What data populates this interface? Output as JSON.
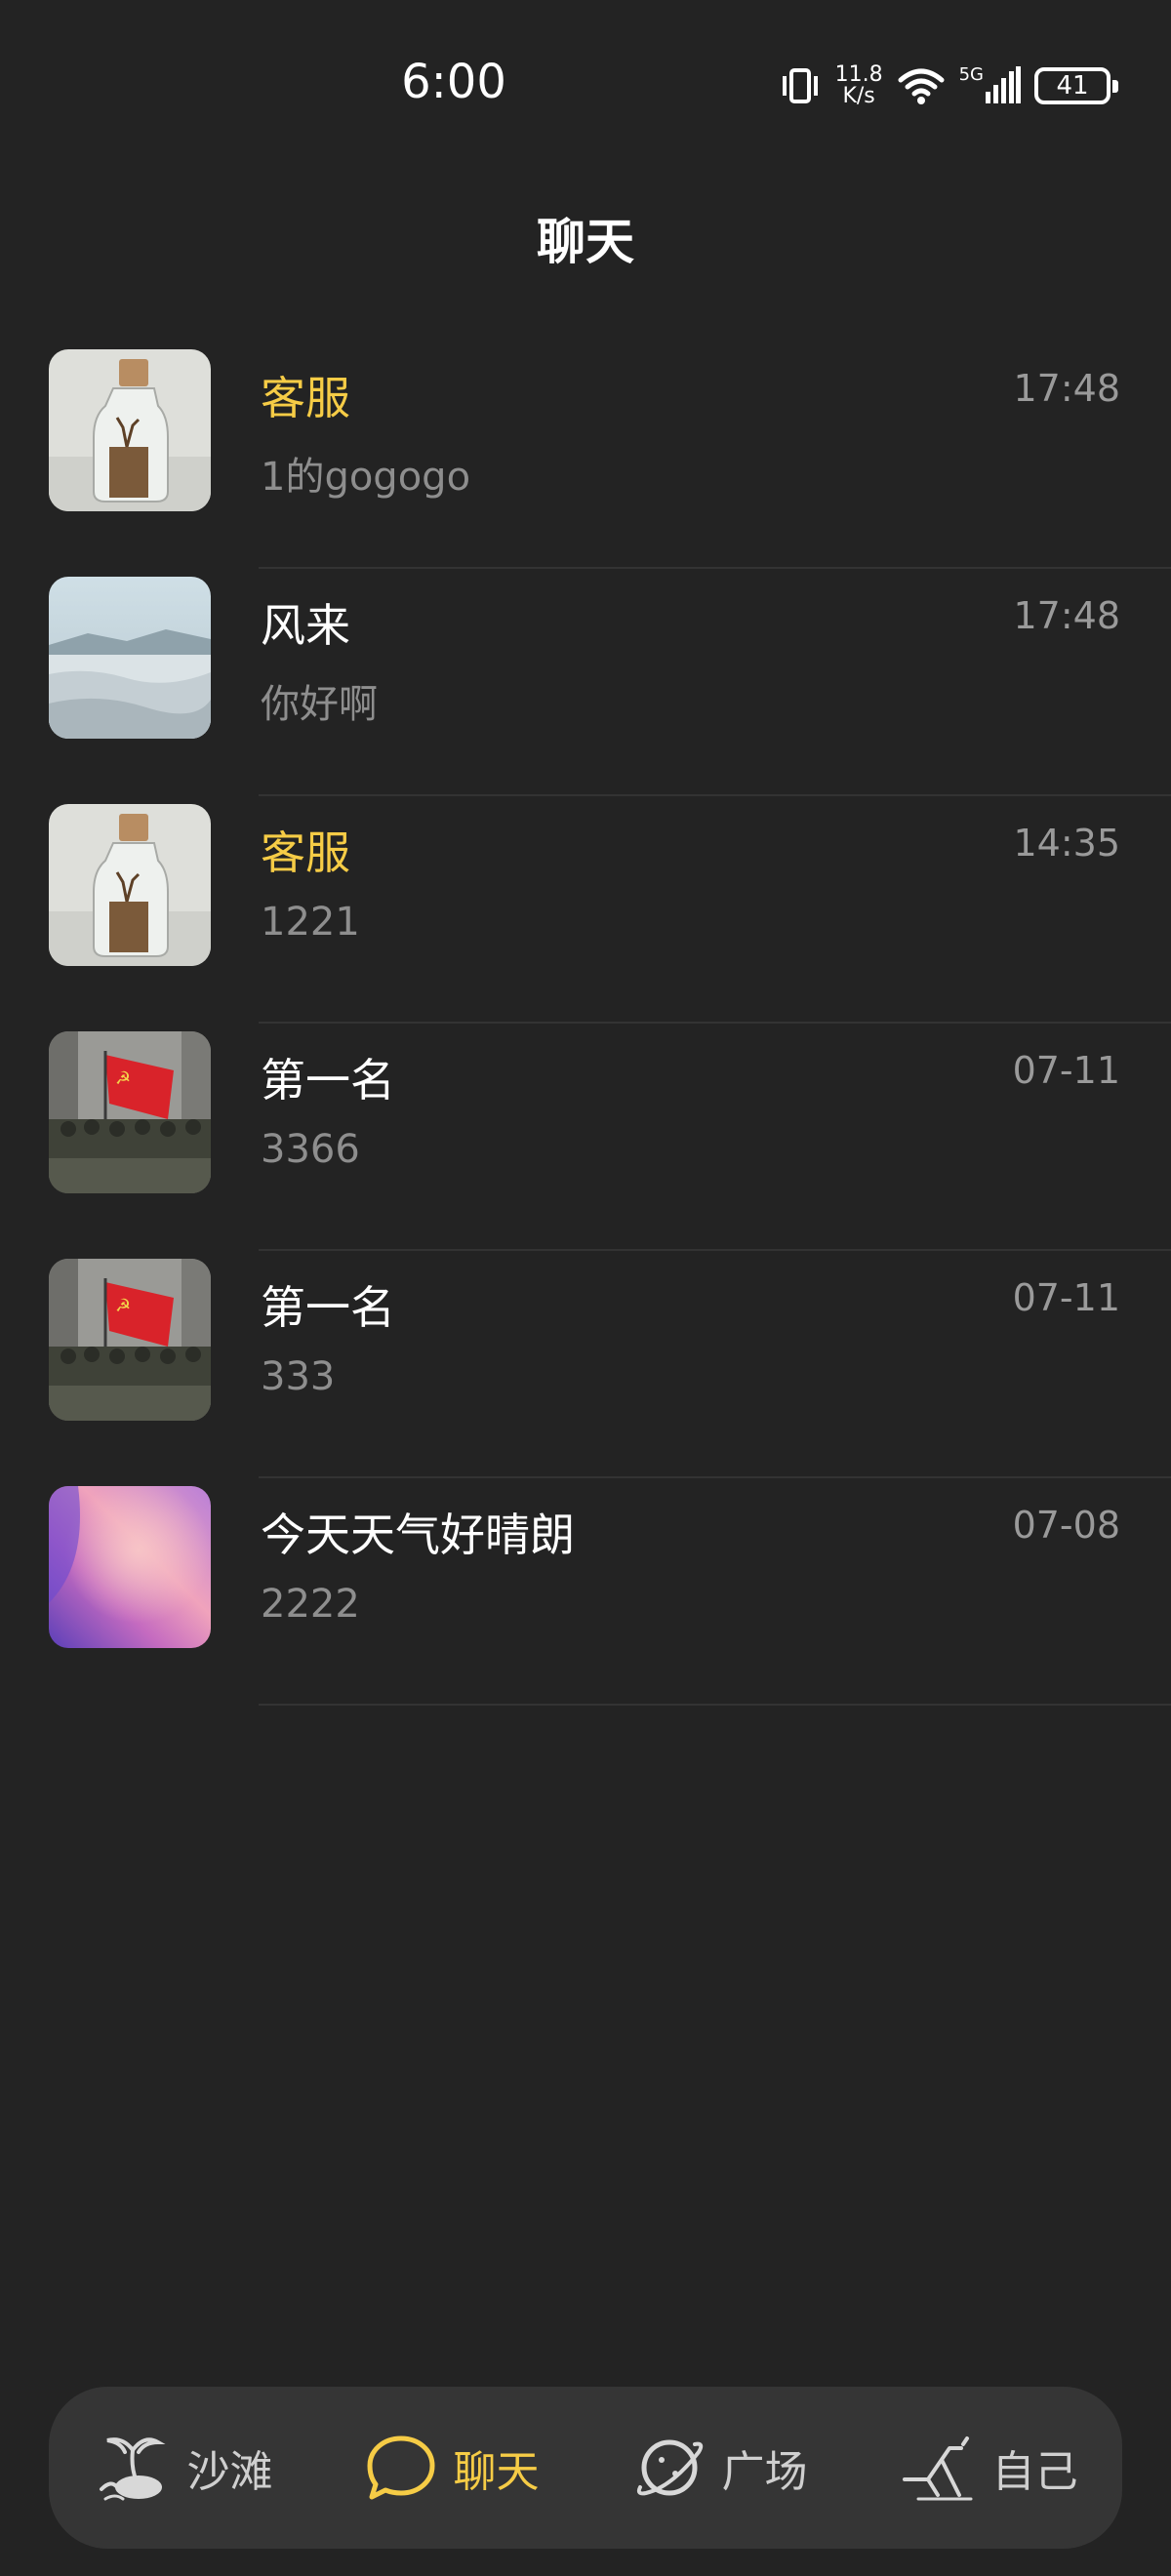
{
  "status_bar": {
    "time": "6:00",
    "net_speed_value": "11.8",
    "net_speed_unit": "K/s",
    "network_type": "5G",
    "battery_level": "41",
    "icons": [
      "vibrate-icon",
      "wifi-icon",
      "cellular-signal-icon",
      "battery-icon"
    ]
  },
  "header": {
    "title": "聊天"
  },
  "chats": [
    {
      "name": "客服",
      "preview": "1的gogogo",
      "time": "17:48",
      "highlight": true,
      "avatar": "bottle-avatar"
    },
    {
      "name": "风来",
      "preview": "你好啊",
      "time": "17:48",
      "highlight": false,
      "avatar": "landscape-avatar"
    },
    {
      "name": "客服",
      "preview": "1221",
      "time": "14:35",
      "highlight": true,
      "avatar": "bottle-avatar"
    },
    {
      "name": "第一名",
      "preview": "3366",
      "time": "07-11",
      "highlight": false,
      "avatar": "flag-crowd-avatar"
    },
    {
      "name": "第一名",
      "preview": "333",
      "time": "07-11",
      "highlight": false,
      "avatar": "flag-crowd-avatar"
    },
    {
      "name": "今天天气好晴朗",
      "preview": "2222",
      "time": "07-08",
      "highlight": false,
      "avatar": "gradient-avatar"
    }
  ],
  "bottom_nav": {
    "items": [
      {
        "label": "沙滩",
        "icon": "beach-island-icon",
        "active": false
      },
      {
        "label": "聊天",
        "icon": "chat-bubble-icon",
        "active": true
      },
      {
        "label": "广场",
        "icon": "planet-icon",
        "active": false
      },
      {
        "label": "自己",
        "icon": "beach-chair-icon",
        "active": false
      }
    ]
  },
  "colors": {
    "background": "#232323",
    "accent": "#f6cc46",
    "nav_background": "#353535",
    "secondary_text": "#8e8e8e"
  }
}
